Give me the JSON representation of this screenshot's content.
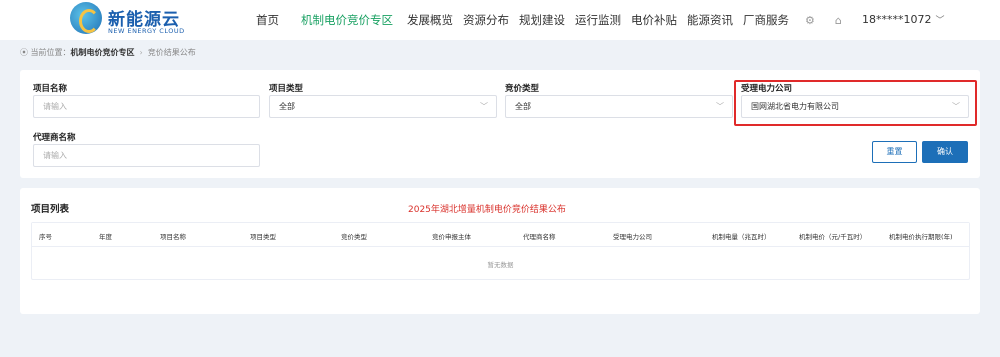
{
  "header": {
    "logo_cn": "新能源云",
    "logo_en": "NEW ENERGY CLOUD",
    "nav": [
      "首页",
      "机制电价竞价专区",
      "发展概览",
      "资源分布",
      "规划建设",
      "运行监测",
      "电价补贴",
      "能源资讯",
      "厂商服务"
    ],
    "active_nav": "机制电价竞价专区",
    "user": "18*****1072"
  },
  "breadcrumb": {
    "prefix": "当前位置：",
    "current": "机制电价竞价专区",
    "page": "竞价结果公布"
  },
  "filters": {
    "project_name": {
      "label": "项目名称",
      "placeholder": "请输入"
    },
    "project_type": {
      "label": "项目类型",
      "value": "全部"
    },
    "bid_type": {
      "label": "竞价类型",
      "value": "全部"
    },
    "power_company": {
      "label": "受理电力公司",
      "value": "国网湖北省电力有限公司"
    },
    "agent_name": {
      "label": "代理商名称",
      "placeholder": "请输入"
    },
    "reset_label": "重置",
    "confirm_label": "确认"
  },
  "list": {
    "title": "项目列表",
    "center_title": "2025年湖北增量机制电价竞价结果公布",
    "columns": [
      "序号",
      "年度",
      "项目名称",
      "项目类型",
      "竞价类型",
      "竞价申报主体",
      "代理商名称",
      "受理电力公司",
      "机制电量（兆瓦时）",
      "机制电价（元/千瓦时）",
      "机制电价执行期限(年)"
    ],
    "empty_text": "暂无数据"
  },
  "colors": {
    "accent": "#1d6fb8",
    "active_nav": "#1aa163",
    "highlight": "#e02a2a",
    "center_title": "#d9312b"
  }
}
